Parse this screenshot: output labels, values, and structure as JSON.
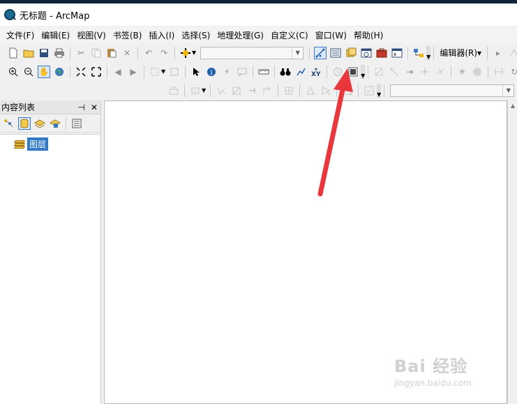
{
  "window": {
    "title": "无标题 - ArcMap"
  },
  "menu": {
    "items": [
      "文件(F)",
      "编辑(E)",
      "视图(V)",
      "书签(B)",
      "插入(I)",
      "选择(S)",
      "地理处理(G)",
      "自定义(C)",
      "窗口(W)",
      "帮助(H)"
    ]
  },
  "toolbar": {
    "editor_label": "编辑器(R)▾",
    "icons": {
      "new": "new-document-icon",
      "open": "open-folder-icon",
      "save": "save-icon",
      "print": "print-icon",
      "cut": "cut-icon",
      "copy": "copy-icon",
      "paste": "paste-icon",
      "delete": "delete-icon",
      "undo": "undo-icon",
      "redo": "redo-icon",
      "add_data": "add-data-icon",
      "editor_toolbar": "editor-toolbar-icon",
      "toc": "table-of-contents-icon",
      "catalog": "catalog-icon",
      "search": "search-window-icon",
      "arctoolbox": "arctoolbox-icon",
      "python": "python-window-icon",
      "model_builder": "model-builder-icon"
    }
  },
  "toc": {
    "title": "内容列表",
    "pin": "⊣",
    "close": "✕",
    "layers_label": "图层"
  },
  "colors": {
    "annotation_arrow": "#e8383d",
    "selection_blue": "#3178c6"
  },
  "watermark": {
    "logo": "Bai 经验",
    "url": "jingyan.baidu.com"
  }
}
